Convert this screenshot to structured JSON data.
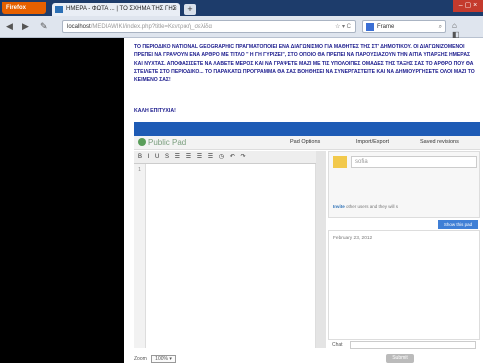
{
  "browser": {
    "app_button": "Firefox",
    "tab_title": "ΗΜΕΡΑ - ΦΩΤΑ ... | ΤΟ ΣΧΗΜΑ ΤΗΣ ΓΗΣ",
    "tab_close": "×",
    "new_tab": "+",
    "window_controls": "– ▢ ×",
    "back": "◀",
    "forward": "▶",
    "history": "✎",
    "address_visible": "localhost",
    "address_muted": "/MEDIAWIKI/index.php?title=Κεντρική_σελίδα",
    "reload": "☆ ▾ C",
    "search_value": "Frame",
    "search_icon": "⌕",
    "toolbar_icons": "⌂ ◧"
  },
  "assignment": {
    "intro": "ΤΟ ΠΕΡΙΟΔΙΚΟ NATIONAL GEOGRAPHIC ΠΡΑΓΜΑΤΟΠΟΙΕΙ ΕΝΑ ΔΙΑΓΩΝΙΣΜΟ ΓΙΑ ΜΑΘΗΤΕΣ ΤΗΣ ΣΤ' ΔΗΜΟΤΙΚΟΥ. ΟΙ ΔΙΑΓΩΝΙΖΟΜΕΝΟΙ ΠΡΕΠΕΙ ΝΑ ΓΡΑΨΟΥΝ ΕΝΑ ΑΡΘΡΟ ΜΕ ΤΙΤΛΟ \" Η ΓΗ ΓΥΡΙΖΕΙ\", ΣΤΟ ΟΠΟΙΟ ΘΑ ΠΡΕΠΕΙ ΝΑ ΠΑΡΟΥΣΙΑΖΟΥΝ ΤΗΝ ΑΙΤΙΑ ΥΠΑΡΞΗΣ ΗΜΕΡΑΣ ΚΑΙ ΝΥΧΤΑΣ. ΑΠΟΦΑΣΙΣΕΤΕ ΝΑ ΛΑΒΕΤΕ ΜΕΡΟΣ ΚΑΙ ΝΑ ΓΡΑΨΕΤΕ ΜΑΖΙ ΜΕ ΤΙΣ ΥΠΟΛΟΙΠΕΣ ΟΜΑΔΕΣ ΤΗΣ ΤΑΞΗΣ ΣΑΣ ΤΟ ΑΡΘΡΟ ΠΟΥ ΘΑ ΣΤΕΙΛΕΤΕ ΣΤΟ ΠΕΡΙΟΔΙΚΟ... ΤΟ ΠΑΡΑΚΑΤΩ ΠΡΟΓΡΑΜΜΑ ΘΑ ΣΑΣ ΒΟΗΘΗΣΕΙ ΝΑ ΣΥΝΕΡΓΑΣΤΕΙΤΕ ΚΑΙ ΝΑ ΔΗΜΙΟΥΡΓΗΣΕΤΕ ΟΛΟΙ ΜΑΖΙ ΤΟ ΚΕΙΜΕΝΟ ΣΑΣ!",
    "wish": "ΚΑΛΗ ΕΠΙΤΥΧΙΑ!"
  },
  "pad": {
    "logo": "Public Pad",
    "pad_options": "Pad Options",
    "import_export": "Import/Export",
    "saved_revisions": "Saved revisions",
    "format_toolbar": "B I U S ☰ ☰ ☰ ☰ ◷ ↶ ↷",
    "line_number": "1",
    "username_value": "sofia",
    "invite_link": "Invite",
    "invite_text": " other users and they will s",
    "show_all": "Show this pad",
    "chat_date": "February 23, 2012",
    "chat_label": "Chat",
    "zoom_label": "Zoom",
    "zoom_value": "100% ▾",
    "submit_label": "Submit"
  },
  "colors": {
    "header_blue": "#1e5bb5",
    "intro_text": "#1a1a8c",
    "firefox_orange": "#e66000"
  }
}
